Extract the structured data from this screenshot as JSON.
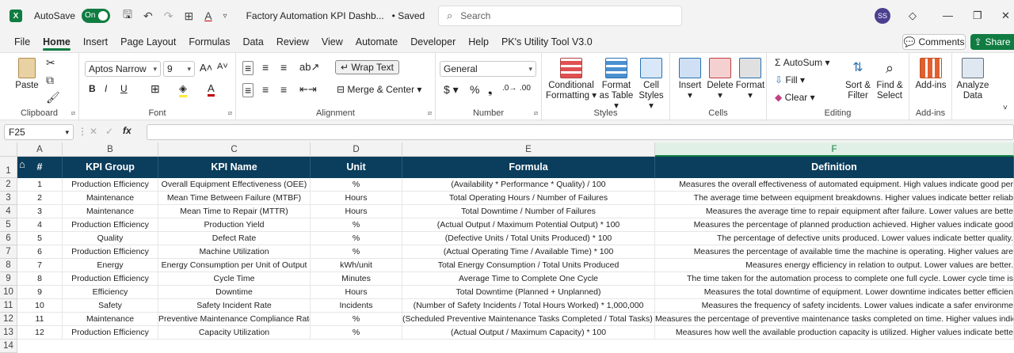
{
  "titlebar": {
    "app_icon": "X",
    "autosave_label": "AutoSave",
    "autosave_state": "On",
    "doc_title": "Factory Automation KPI Dashb...",
    "saved_status": "• Saved",
    "search_placeholder": "Search",
    "user_initials": "SS"
  },
  "menu": [
    "File",
    "Home",
    "Insert",
    "Page Layout",
    "Formulas",
    "Data",
    "Review",
    "View",
    "Automate",
    "Developer",
    "Help",
    "PK's Utility Tool V3.0"
  ],
  "comments_label": "Comments",
  "share_label": "Share",
  "ribbon": {
    "clipboard": {
      "paste": "Paste",
      "label": "Clipboard"
    },
    "font": {
      "name": "Aptos Narrow",
      "size": "9",
      "label": "Font"
    },
    "alignment": {
      "wrap": "Wrap Text",
      "merge": "Merge & Center",
      "label": "Alignment"
    },
    "number": {
      "format": "General",
      "label": "Number"
    },
    "styles": {
      "cond": "Conditional Formatting",
      "table": "Format as Table",
      "cell": "Cell Styles",
      "label": "Styles"
    },
    "cells": {
      "insert": "Insert",
      "delete": "Delete",
      "format": "Format",
      "label": "Cells"
    },
    "editing": {
      "autosum": "AutoSum",
      "fill": "Fill",
      "clear": "Clear",
      "sort": "Sort & Filter",
      "find": "Find & Select",
      "label": "Editing"
    },
    "addins": {
      "addins": "Add-ins",
      "label": "Add-ins"
    },
    "analyze": {
      "label": "Analyze Data"
    }
  },
  "formula_bar": {
    "name_box": "F25",
    "fx": "fx",
    "content": ""
  },
  "columns": [
    "A",
    "B",
    "C",
    "D",
    "E",
    "F"
  ],
  "header": [
    "#",
    "KPI Group",
    "KPI Name",
    "Unit",
    "Formula",
    "Definition"
  ],
  "rows": [
    [
      "1",
      "Production Efficiency",
      "Overall Equipment Effectiveness (OEE)",
      "%",
      "(Availability * Performance * Quality) / 100",
      "Measures the overall effectiveness of automated equipment. High values indicate good per"
    ],
    [
      "2",
      "Maintenance",
      "Mean Time Between Failure (MTBF)",
      "Hours",
      "Total Operating Hours / Number of Failures",
      "The average time between equipment breakdowns. Higher values indicate better reliab"
    ],
    [
      "3",
      "Maintenance",
      "Mean Time to Repair (MTTR)",
      "Hours",
      "Total Downtime / Number of Failures",
      "Measures the average time to repair equipment after failure. Lower values are bette"
    ],
    [
      "4",
      "Production Efficiency",
      "Production Yield",
      "%",
      "(Actual Output / Maximum Potential Output) * 100",
      "Measures the percentage of planned production achieved. Higher values indicate good"
    ],
    [
      "5",
      "Quality",
      "Defect Rate",
      "%",
      "(Defective Units / Total Units Produced) * 100",
      "The percentage of defective units produced. Lower values indicate better quality."
    ],
    [
      "6",
      "Production Efficiency",
      "Machine Utilization",
      "%",
      "(Actual Operating Time / Available Time) * 100",
      "Measures the percentage of available time the machine is operating. Higher values are"
    ],
    [
      "7",
      "Energy",
      "Energy Consumption per Unit of Output",
      "kWh/unit",
      "Total Energy Consumption / Total Units Produced",
      "Measures energy efficiency in relation to output. Lower values are better."
    ],
    [
      "8",
      "Production Efficiency",
      "Cycle Time",
      "Minutes",
      "Average Time to Complete One Cycle",
      "The time taken for the automation process to complete one full cycle. Lower cycle time is"
    ],
    [
      "9",
      "Efficiency",
      "Downtime",
      "Hours",
      "Total Downtime (Planned + Unplanned)",
      "Measures the total downtime of equipment. Lower downtime indicates better efficien"
    ],
    [
      "10",
      "Safety",
      "Safety Incident Rate",
      "Incidents",
      "(Number of Safety Incidents / Total Hours Worked) * 1,000,000",
      "Measures the frequency of safety incidents. Lower values indicate a safer environme"
    ],
    [
      "11",
      "Maintenance",
      "Preventive Maintenance Compliance Rate",
      "%",
      "(Scheduled Preventive Maintenance Tasks Completed / Total Tasks) * 100",
      "Measures the percentage of preventive maintenance tasks completed on time. Higher values indicate bette"
    ],
    [
      "12",
      "Production Efficiency",
      "Capacity Utilization",
      "%",
      "(Actual Output / Maximum Capacity) * 100",
      "Measures how well the available production capacity is utilized. Higher values indicate bette"
    ]
  ],
  "row_numbers": [
    "1",
    "2",
    "3",
    "4",
    "5",
    "6",
    "7",
    "8",
    "9",
    "10",
    "11",
    "12",
    "13",
    "14"
  ]
}
